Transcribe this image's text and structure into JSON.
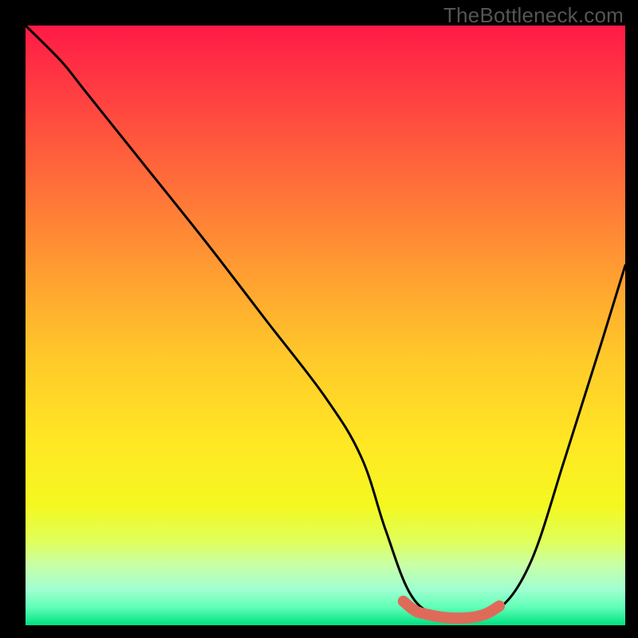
{
  "watermark": "TheBottleneck.com",
  "chart_data": {
    "type": "line",
    "title": "",
    "xlabel": "",
    "ylabel": "",
    "xlim": [
      0,
      100
    ],
    "ylim": [
      0,
      100
    ],
    "series": [
      {
        "name": "curve",
        "x": [
          0,
          6,
          10,
          20,
          30,
          40,
          50,
          56,
          60,
          64,
          68,
          72,
          78,
          84,
          90,
          96,
          100
        ],
        "y": [
          100,
          94,
          89,
          76.5,
          64,
          51,
          38,
          28,
          16,
          5.5,
          1.8,
          1.2,
          2,
          10,
          28,
          47,
          60
        ]
      },
      {
        "name": "optimal-zone",
        "x": [
          63,
          65,
          67,
          69,
          71,
          73,
          75,
          77,
          79
        ],
        "y": [
          4.0,
          2.4,
          1.8,
          1.4,
          1.2,
          1.2,
          1.4,
          2.0,
          3.2
        ]
      }
    ],
    "gradient_stops": [
      {
        "offset": 0.0,
        "color": "#ff1a46"
      },
      {
        "offset": 0.1,
        "color": "#ff3a42"
      },
      {
        "offset": 0.25,
        "color": "#ff6a3a"
      },
      {
        "offset": 0.4,
        "color": "#ff9a32"
      },
      {
        "offset": 0.55,
        "color": "#ffc82a"
      },
      {
        "offset": 0.7,
        "color": "#ffe824"
      },
      {
        "offset": 0.8,
        "color": "#f4f820"
      },
      {
        "offset": 0.86,
        "color": "#e0ff5a"
      },
      {
        "offset": 0.9,
        "color": "#c8ffa8"
      },
      {
        "offset": 0.94,
        "color": "#a0ffd0"
      },
      {
        "offset": 0.97,
        "color": "#60ffb8"
      },
      {
        "offset": 1.0,
        "color": "#00e080"
      }
    ],
    "accent_color": "#e06a5a",
    "curve_color": "#000000"
  }
}
